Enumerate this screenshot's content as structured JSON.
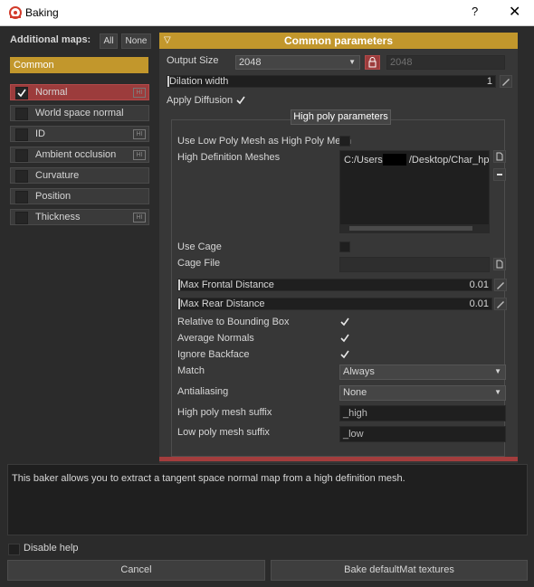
{
  "window": {
    "title": "Baking",
    "help": "?",
    "close": "✕"
  },
  "left": {
    "additional_maps_label": "Additional maps:",
    "all_button": "All",
    "none_button": "None",
    "common_tab": "Common",
    "maps": [
      {
        "label": "Normal",
        "checked": true,
        "hi": true,
        "active": true
      },
      {
        "label": "World space normal",
        "checked": false,
        "hi": false,
        "active": false
      },
      {
        "label": "ID",
        "checked": false,
        "hi": true,
        "active": false
      },
      {
        "label": "Ambient occlusion",
        "checked": false,
        "hi": true,
        "active": false
      },
      {
        "label": "Curvature",
        "checked": false,
        "hi": false,
        "active": false
      },
      {
        "label": "Position",
        "checked": false,
        "hi": false,
        "active": false
      },
      {
        "label": "Thickness",
        "checked": false,
        "hi": true,
        "active": false
      }
    ],
    "hi_badge": "HI"
  },
  "common": {
    "header": "Common parameters",
    "output_size_label": "Output Size",
    "output_size_value": "2048",
    "output_size_linked": "2048",
    "dilation_label": "Dilation width",
    "dilation_value": "1",
    "apply_diffusion_label": "Apply Diffusion",
    "apply_diffusion": true
  },
  "high_poly": {
    "title": "High poly parameters",
    "use_low_as_high_label": "Use Low Poly Mesh as High Poly Mesh",
    "use_low_as_high": false,
    "hd_meshes_label": "High Definition Meshes",
    "hd_mesh_path_start": "C:/Users/",
    "hd_mesh_path_end": "/Desktop/Char_hp_",
    "use_cage_label": "Use Cage",
    "use_cage": false,
    "cage_file_label": "Cage File",
    "cage_file_value": "",
    "max_frontal_label": "Max Frontal Distance",
    "max_frontal_value": "0.01",
    "max_rear_label": "Max Rear Distance",
    "max_rear_value": "0.01",
    "relative_bbox_label": "Relative to Bounding Box",
    "relative_bbox": true,
    "average_normals_label": "Average Normals",
    "average_normals": true,
    "ignore_backface_label": "Ignore Backface",
    "ignore_backface": true,
    "match_label": "Match",
    "match_value": "Always",
    "antialiasing_label": "Antialiasing",
    "antialiasing_value": "None",
    "high_suffix_label": "High poly mesh suffix",
    "high_suffix_value": "_high",
    "low_suffix_label": "Low poly mesh suffix",
    "low_suffix_value": "_low"
  },
  "help": {
    "text": "This baker allows you to extract a tangent space normal map from a high definition mesh.",
    "disable_help_label": "Disable help",
    "disable_help": false
  },
  "footer": {
    "cancel_label": "Cancel",
    "bake_label": "Bake defaultMat textures"
  },
  "colors": {
    "accent_gold": "#c2972c",
    "active_red": "#9c3c3c"
  }
}
